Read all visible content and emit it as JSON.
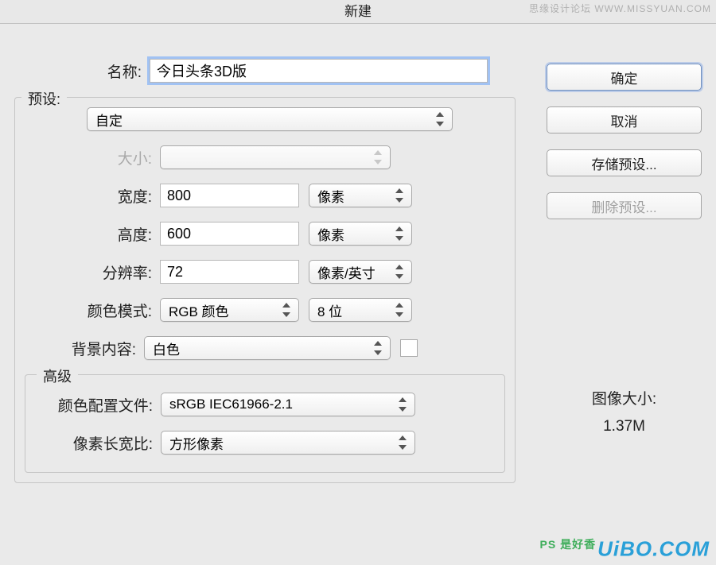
{
  "title": "新建",
  "watermark_top": "思缘设计论坛  WWW.MISSYUAN.COM",
  "watermark_bottom_ps": "PS 是好香",
  "watermark_bottom": "UiBO.COM",
  "buttons": {
    "ok": "确定",
    "cancel": "取消",
    "save_preset": "存储预设...",
    "delete_preset": "删除预设..."
  },
  "info": {
    "label": "图像大小:",
    "value": "1.37M"
  },
  "fields": {
    "name_label": "名称:",
    "name_value": "今日头条3D版",
    "preset_label": "预设:",
    "preset_value": "自定",
    "size_label": "大小:",
    "size_value": "",
    "width_label": "宽度:",
    "width_value": "800",
    "width_unit": "像素",
    "height_label": "高度:",
    "height_value": "600",
    "height_unit": "像素",
    "resolution_label": "分辨率:",
    "resolution_value": "72",
    "resolution_unit": "像素/英寸",
    "color_mode_label": "颜色模式:",
    "color_mode_value": "RGB 颜色",
    "color_depth_value": "8 位",
    "bg_label": "背景内容:",
    "bg_value": "白色",
    "advanced_legend": "高级",
    "profile_label": "颜色配置文件:",
    "profile_value": "sRGB IEC61966-2.1",
    "aspect_label": "像素长宽比:",
    "aspect_value": "方形像素"
  }
}
